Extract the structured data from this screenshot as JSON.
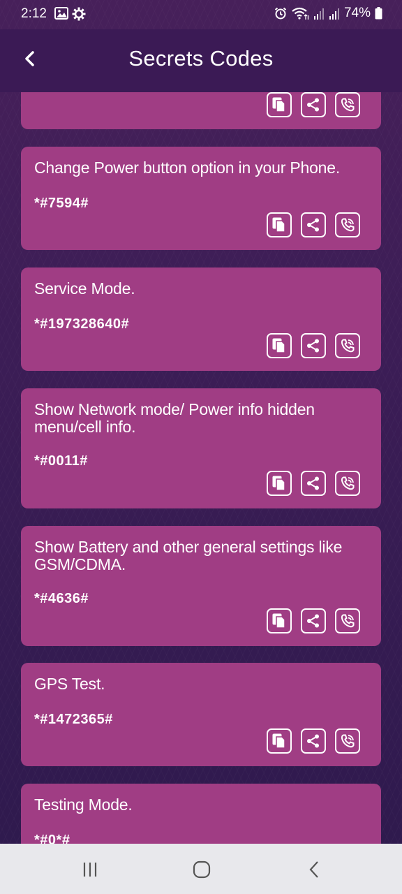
{
  "status": {
    "time": "2:12",
    "battery": "74%",
    "icons": [
      "gallery-icon",
      "settings-gear-icon",
      "alarm-icon",
      "wifi-icon",
      "signal-icon",
      "signal-icon",
      "battery-icon"
    ]
  },
  "header": {
    "back_icon": "chevron-left-icon",
    "title": "Secrets Codes"
  },
  "codes": [
    {
      "description": "",
      "code": ""
    },
    {
      "description": "Change Power button option in your Phone.",
      "code": "*#7594#"
    },
    {
      "description": "Service Mode.",
      "code": "*#197328640#"
    },
    {
      "description": "Show Network mode/ Power info hidden menu/cell info.",
      "code": "*#0011#"
    },
    {
      "description": "Show Battery and other general settings like GSM/CDMA.",
      "code": "*#4636#"
    },
    {
      "description": "GPS Test.",
      "code": "*#1472365#"
    },
    {
      "description": "Testing Mode.",
      "code": "*#0*#"
    }
  ],
  "card_actions": [
    "copy-icon",
    "share-icon",
    "dial-icon"
  ],
  "nav": {
    "buttons": [
      "recents-icon",
      "home-icon",
      "back-icon"
    ]
  },
  "colors": {
    "background": "#3a1c52",
    "app_bar": "#3b1a55",
    "card": "#a03d84",
    "text": "#ffffff",
    "nav_bar": "#e8e8ec"
  }
}
